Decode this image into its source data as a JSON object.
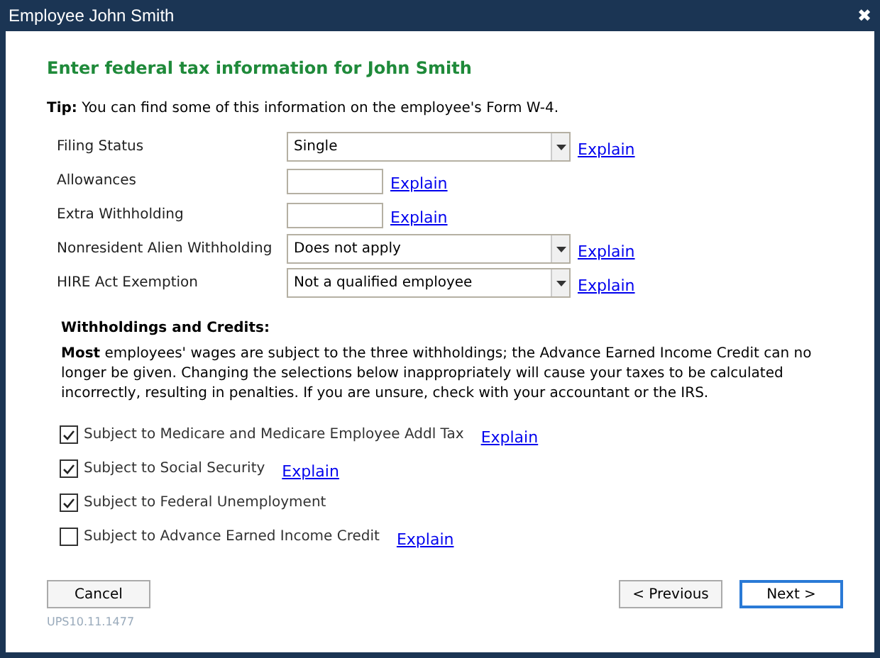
{
  "window": {
    "title": "Employee John Smith",
    "close": "✖"
  },
  "heading": "Enter federal tax information for John Smith",
  "tip": "**Tip:**  You can find some of this information on the employee's Form W-4.",
  "fields": [
    {
      "label": "Filing Status",
      "kind": "select",
      "value": "Single",
      "explain": "Explain"
    },
    {
      "label": "Allowances",
      "kind": "text",
      "explain": "Explain"
    },
    {
      "label": "Extra Withholding",
      "kind": "text",
      "explain": "Explain"
    },
    {
      "label": "Nonresident Alien Withholding",
      "kind": "select",
      "value": "Does not apply",
      "explain": "Explain"
    },
    {
      "label": "HIRE Act Exemption",
      "kind": "select",
      "value": "Not a qualified employee",
      "explain": "Explain"
    }
  ],
  "withholdings": {
    "title": "Withholdings and Credits:",
    "note": "**Most** employees' wages are subject to the three withholdings; the Advance Earned Income Credit can no longer be given.  Changing the selections below inappropriately will cause your taxes to be calculated incorrectly, resulting in penalties. If you are unsure, check with your accountant or the IRS.",
    "options": [
      {
        "label": "Subject to Medicare and Medicare Employee Addl Tax",
        "checked": true,
        "explain": "Explain"
      },
      {
        "label": "Subject to Social Security",
        "checked": true,
        "explain": "Explain"
      },
      {
        "label": "Subject to Federal Unemployment",
        "checked": true
      },
      {
        "label": "Subject to Advance Earned Income Credit",
        "checked": false,
        "explain": "Explain"
      }
    ]
  },
  "buttons": {
    "cancel": "Cancel",
    "previous": "< Previous",
    "next": "Next >"
  },
  "version": "UPS10.11.1477"
}
